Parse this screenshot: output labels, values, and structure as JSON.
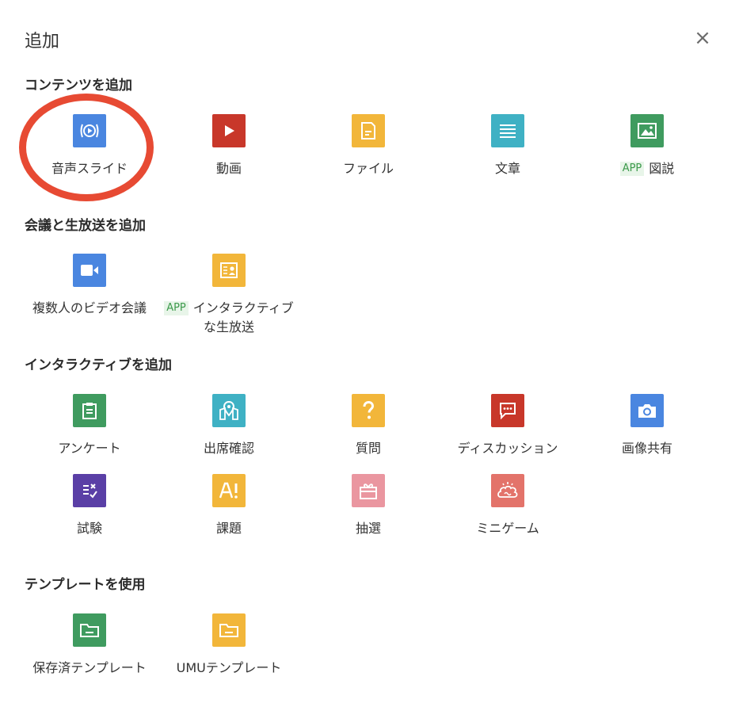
{
  "dialog": {
    "title": "追加",
    "close_label": "×"
  },
  "colors": {
    "blue": "#4a86e0",
    "red": "#c8372a",
    "yellow": "#f2b63a",
    "teal": "#3fb1c4",
    "green": "#3f9b5f",
    "purple": "#5a3fa6",
    "pink": "#ea96a0",
    "salmon": "#e3736a",
    "highlight_ring": "#e74a33"
  },
  "app_badge": "APP",
  "sections": [
    {
      "title": "コンテンツを追加",
      "items": [
        {
          "label": "音声スライド",
          "icon": "audio-slide-icon",
          "color": "blue",
          "highlighted": true
        },
        {
          "label": "動画",
          "icon": "video-play-icon",
          "color": "red"
        },
        {
          "label": "ファイル",
          "icon": "file-icon",
          "color": "yellow"
        },
        {
          "label": "文章",
          "icon": "article-icon",
          "color": "teal"
        },
        {
          "label": "図説",
          "icon": "image-icon",
          "color": "green",
          "app": true
        }
      ]
    },
    {
      "title": "会議と生放送を追加",
      "items": [
        {
          "label": "複数人のビデオ会議",
          "icon": "video-camera-icon",
          "color": "blue"
        },
        {
          "label": "インタラクティブな生放送",
          "icon": "live-broadcast-icon",
          "color": "yellow",
          "app": true
        }
      ]
    },
    {
      "title": "インタラクティブを追加",
      "items": [
        {
          "label": "アンケート",
          "icon": "survey-icon",
          "color": "green"
        },
        {
          "label": "出席確認",
          "icon": "map-pin-icon",
          "color": "teal"
        },
        {
          "label": "質問",
          "icon": "question-icon",
          "color": "yellow"
        },
        {
          "label": "ディスカッション",
          "icon": "chat-icon",
          "color": "red"
        },
        {
          "label": "画像共有",
          "icon": "camera-icon",
          "color": "blue"
        },
        {
          "label": "試験",
          "icon": "exam-icon",
          "color": "purple"
        },
        {
          "label": "課題",
          "icon": "assignment-icon",
          "color": "yellow"
        },
        {
          "label": "抽選",
          "icon": "gift-icon",
          "color": "pink"
        },
        {
          "label": "ミニゲーム",
          "icon": "brain-game-icon",
          "color": "salmon"
        }
      ]
    },
    {
      "title": "テンプレートを使用",
      "items": [
        {
          "label": "保存済テンプレート",
          "icon": "folder-icon",
          "color": "green"
        },
        {
          "label": "UMUテンプレート",
          "icon": "folder-icon",
          "color": "yellow"
        }
      ]
    }
  ]
}
